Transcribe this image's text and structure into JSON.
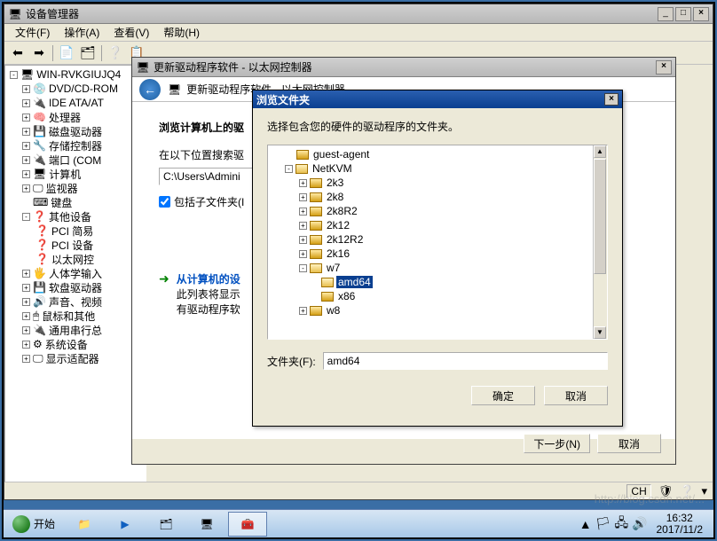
{
  "devmgr": {
    "title": "设备管理器",
    "menu": {
      "file": "文件(F)",
      "action": "操作(A)",
      "view": "查看(V)",
      "help": "帮助(H)"
    },
    "root": "WIN-RVKGIUJQ4",
    "nodes": [
      "DVD/CD-ROM",
      "IDE ATA/AT",
      "处理器",
      "磁盘驱动器",
      "存储控制器",
      "端口 (COM",
      "计算机",
      "监视器",
      "键盘"
    ],
    "other_label": "其他设备",
    "other_items": [
      "PCI 简易",
      "PCI 设备",
      "以太网控"
    ],
    "nodes2": [
      "人体学输入",
      "软盘驱动器",
      "声音、视频",
      "鼠标和其他",
      "通用串行总",
      "系统设备",
      "显示适配器"
    ]
  },
  "drvdlg": {
    "title": "更新驱动程序软件 - 以太网控制器",
    "header": "更新驱动程序软件 - 以太网控制器",
    "browse_label": "浏览计算机上的驱",
    "search_label": "在以下位置搜索驱",
    "path": "C:\\Users\\Admini",
    "include_sub": "包括子文件夹(I",
    "from_list": "从计算机的设",
    "from_list2": "此列表将显示",
    "from_list3": "有驱动程序软",
    "next": "下一步(N)",
    "cancel": "取消"
  },
  "browse": {
    "title": "浏览文件夹",
    "msg": "选择包含您的硬件的驱动程序的文件夹。",
    "tree": {
      "guest_agent": "guest-agent",
      "netkvm": "NetKVM",
      "children": [
        "2k3",
        "2k8",
        "2k8R2",
        "2k12",
        "2k12R2",
        "2k16"
      ],
      "w7": "w7",
      "amd64": "amd64",
      "x86": "x86",
      "w8": "w8"
    },
    "folder_label": "文件夹(F):",
    "folder_value": "amd64",
    "ok": "确定",
    "cancel": "取消"
  },
  "statusbar": {
    "lang": "CH"
  },
  "taskbar": {
    "start": "开始",
    "time": "16:32",
    "date": "2017/11/2"
  },
  "watermark": "http://blog.csdn.net/..."
}
